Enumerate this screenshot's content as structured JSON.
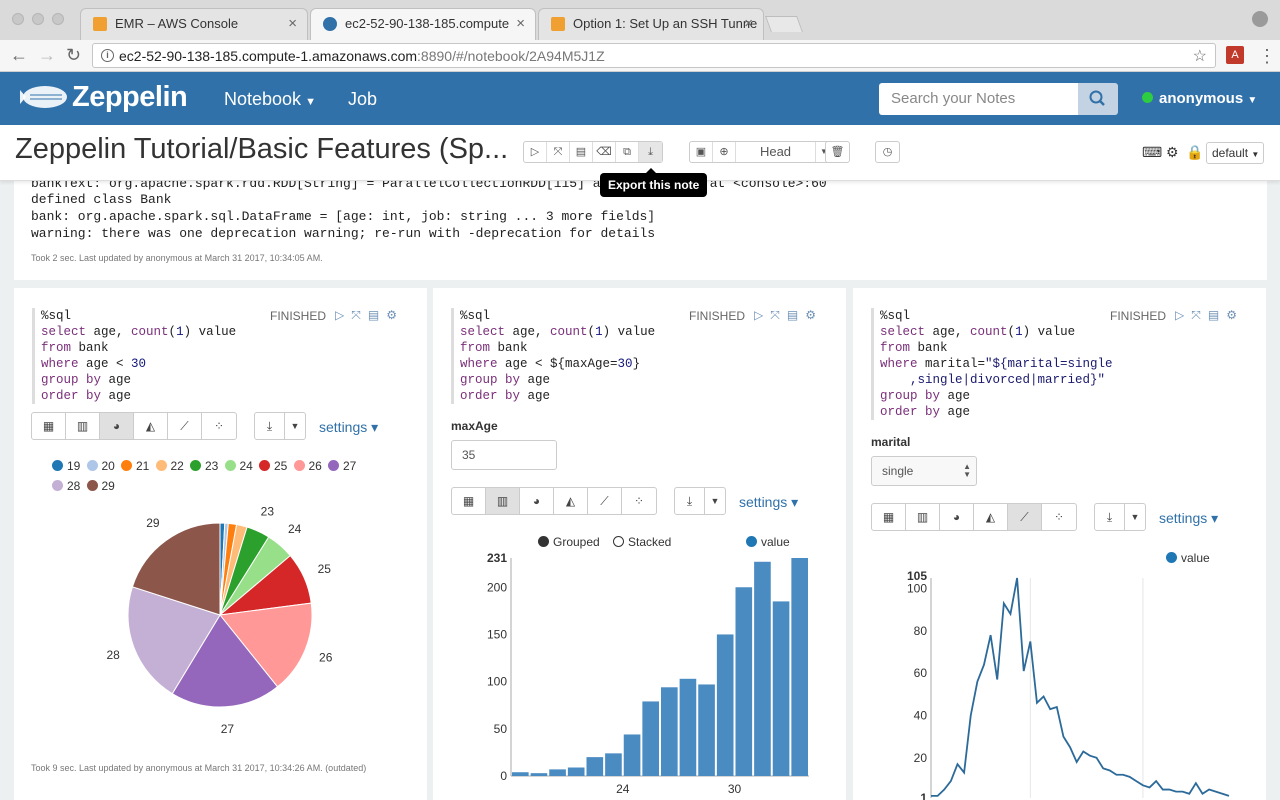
{
  "browser": {
    "tabs": [
      {
        "label": "EMR – AWS Console",
        "active": false
      },
      {
        "label": "ec2-52-90-138-185.compute",
        "active": true
      },
      {
        "label": "Option 1: Set Up an SSH Tunne",
        "active": false
      }
    ],
    "url_host": "ec2-52-90-138-185.compute-1.amazonaws.com",
    "url_path": ":8890/#/notebook/2A94M5J1Z"
  },
  "header": {
    "brand": "Zeppelin",
    "nav": [
      {
        "label": "Notebook"
      },
      {
        "label": "Job"
      }
    ],
    "search_placeholder": "Search your Notes",
    "user": "anonymous"
  },
  "note": {
    "title": "Zeppelin Tutorial/Basic Features (Sp...",
    "head_label": "Head",
    "tooltip": "Export this note",
    "interpreter": "default"
  },
  "output": {
    "lines": [
      "bankText: org.apache.spark.rdd.RDD[String] = ParallelCollectionRDD[115] at parallelize at <console>:60",
      "defined class Bank",
      "bank: org.apache.spark.sql.DataFrame = [age: int, job: string ... 3 more fields]",
      "warning: there was one deprecation warning; re-run with -deprecation for details"
    ],
    "meta": "Took 2 sec. Last updated by anonymous at March 31 2017, 10:34:05 AM."
  },
  "panels": [
    {
      "status": "FINISHED",
      "code": [
        "%sql",
        "select age, count(1) value",
        "from bank",
        "where age < 30",
        "group by age",
        "order by age"
      ],
      "settings": "settings",
      "meta": "Took 9 sec. Last updated by anonymous at March 31 2017, 10:34:26 AM. (outdated)"
    },
    {
      "status": "FINISHED",
      "code": [
        "%sql",
        "select age, count(1) value",
        "from bank",
        "where age < ${maxAge=30}",
        "group by age",
        "order by age"
      ],
      "form_label": "maxAge",
      "form_value": "35",
      "settings": "settings",
      "legend_grouped": "Grouped",
      "legend_stacked": "Stacked",
      "legend_value": "value"
    },
    {
      "status": "FINISHED",
      "code": [
        "%sql",
        "select age, count(1) value",
        "from bank",
        "where marital=\"${marital=single",
        "    ,single|divorced|married}\"",
        "group by age",
        "order by age"
      ],
      "form_label": "marital",
      "form_value": "single",
      "settings": "settings",
      "legend_value": "value"
    }
  ],
  "chart_data": [
    {
      "type": "pie",
      "categories": [
        "19",
        "20",
        "21",
        "22",
        "23",
        "24",
        "25",
        "26",
        "27",
        "28",
        "29"
      ],
      "values": [
        4,
        3,
        7,
        9,
        20,
        24,
        44,
        79,
        94,
        103,
        97
      ],
      "colors": [
        "#1f77b4",
        "#aec7e8",
        "#ff7f0e",
        "#ffbb78",
        "#2ca02c",
        "#98df8a",
        "#d62728",
        "#ff9896",
        "#9467bd",
        "#c5b0d5",
        "#8c564b"
      ],
      "visible_labels": [
        "23",
        "24",
        "25",
        "26",
        "27",
        "28",
        "29"
      ]
    },
    {
      "type": "bar",
      "categories": [
        "19",
        "20",
        "21",
        "22",
        "23",
        "24",
        "25",
        "26",
        "27",
        "28",
        "29",
        "30",
        "31",
        "32",
        "33",
        "34"
      ],
      "values": [
        4,
        3,
        7,
        9,
        20,
        24,
        44,
        79,
        94,
        103,
        97,
        150,
        200,
        227,
        185,
        231
      ],
      "ylim": [
        0,
        231
      ],
      "yticks": [
        0,
        50,
        100,
        150,
        200,
        231
      ],
      "xticks": [
        "24",
        "30"
      ],
      "series_name": "value",
      "color": "#4a8bc2"
    },
    {
      "type": "line",
      "x": [
        19,
        20,
        21,
        22,
        23,
        24,
        25,
        26,
        27,
        28,
        29,
        30,
        31,
        32,
        33,
        34,
        35,
        36,
        37,
        38,
        39,
        40,
        41,
        42,
        43,
        44,
        45,
        46,
        47,
        48,
        49,
        50,
        51,
        52,
        53,
        54,
        55,
        56,
        57,
        58,
        59,
        60,
        61,
        62,
        63,
        64
      ],
      "values": [
        2,
        2,
        5,
        9,
        17,
        13,
        40,
        56,
        64,
        78,
        57,
        93,
        88,
        105,
        61,
        75,
        46,
        49,
        43,
        44,
        30,
        25,
        18,
        23,
        21,
        20,
        15,
        14,
        12,
        12,
        11,
        9,
        7,
        6,
        9,
        5,
        5,
        4,
        4,
        3,
        8,
        3,
        5,
        4,
        3,
        2
      ],
      "ylim": [
        1,
        105
      ],
      "yticks": [
        1,
        20,
        40,
        60,
        80,
        100,
        105
      ],
      "series_name": "value",
      "color": "#2c6a99"
    }
  ]
}
